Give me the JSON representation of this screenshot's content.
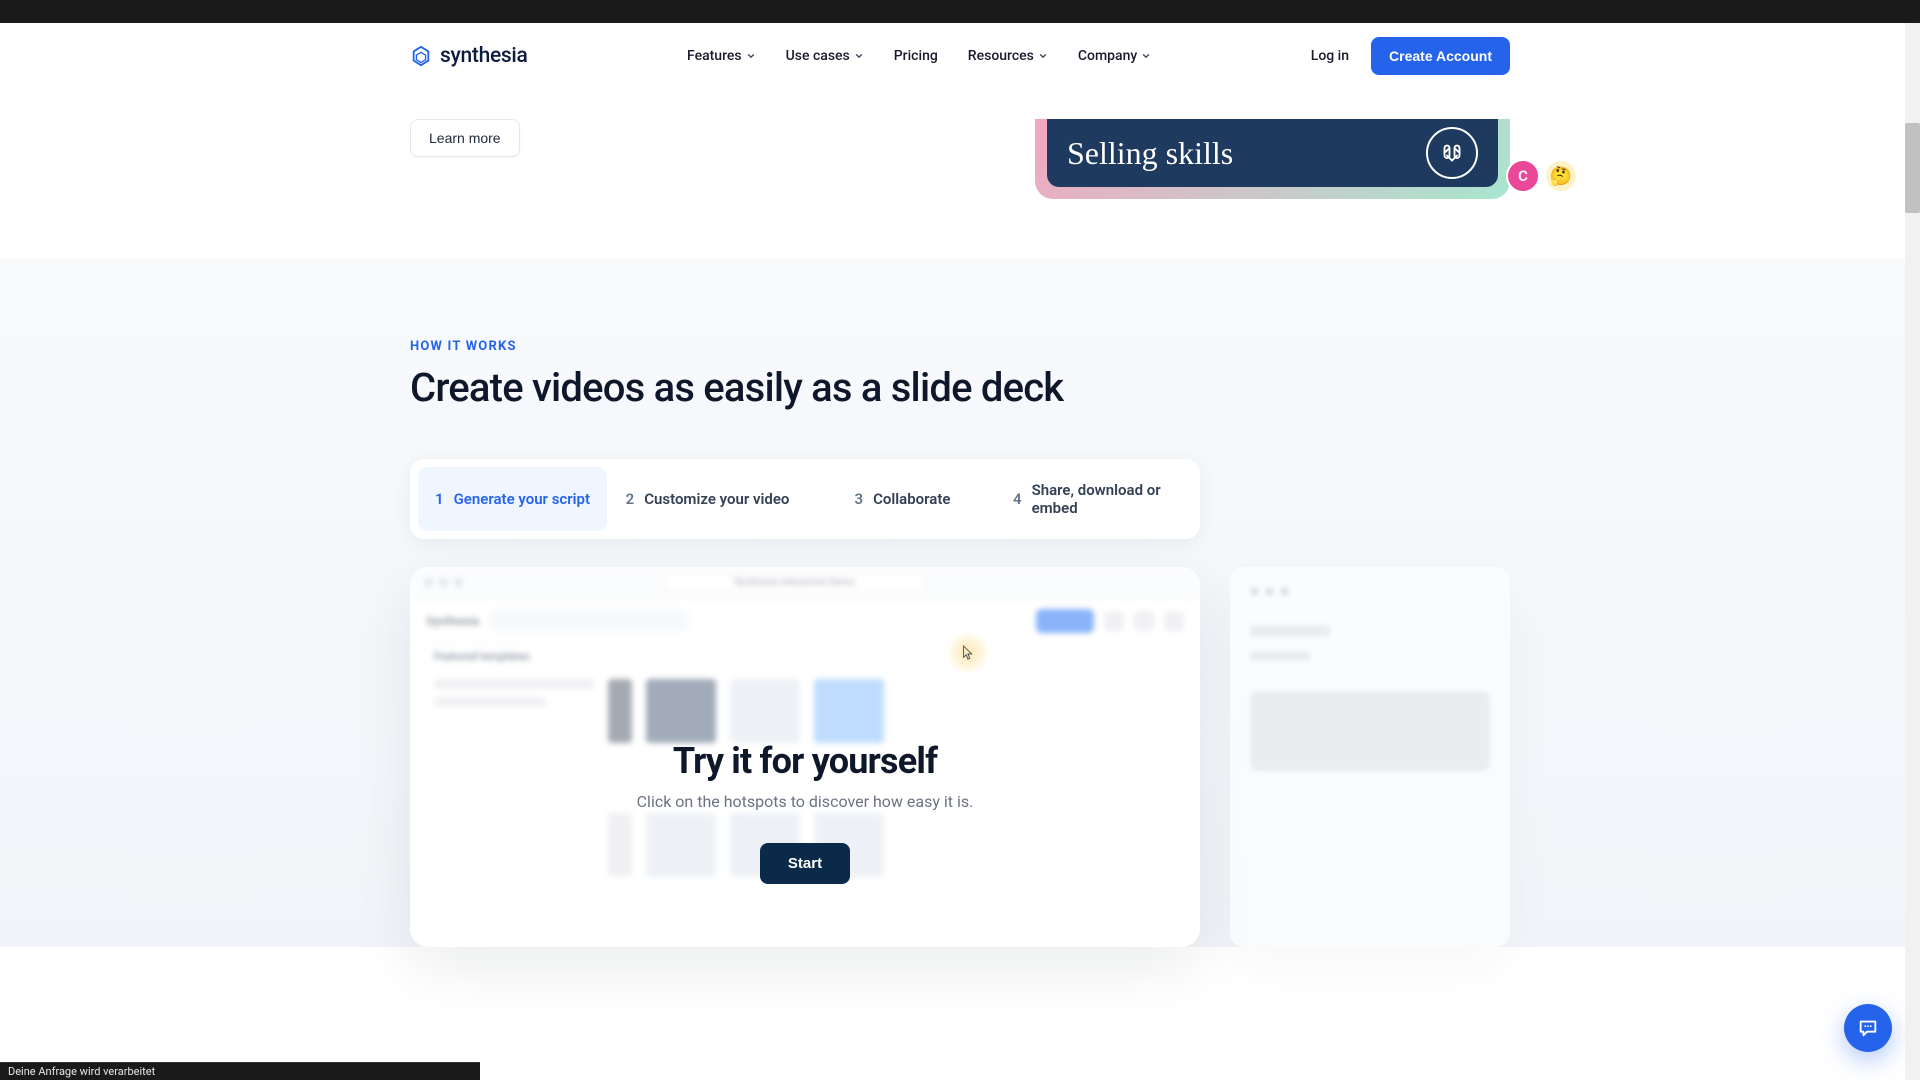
{
  "header": {
    "brand": "synthesia",
    "nav": [
      {
        "label": "Features",
        "dropdown": true
      },
      {
        "label": "Use cases",
        "dropdown": true
      },
      {
        "label": "Pricing",
        "dropdown": false
      },
      {
        "label": "Resources",
        "dropdown": true
      },
      {
        "label": "Company",
        "dropdown": true
      }
    ],
    "login": "Log in",
    "cta": "Create Account"
  },
  "topSection": {
    "learnMore": "Learn more",
    "cardTitle": "Selling skills",
    "reactionLetter": "C",
    "reactionEmoji": "🤔"
  },
  "howItWorks": {
    "eyebrow": "HOW IT WORKS",
    "heading": "Create videos as easily as a slide deck",
    "steps": [
      {
        "num": "1",
        "label": "Generate your script",
        "active": true
      },
      {
        "num": "2",
        "label": "Customize your video",
        "active": false
      },
      {
        "num": "3",
        "label": "Collaborate",
        "active": false
      },
      {
        "num": "4",
        "label": "Share, download or embed",
        "active": false
      }
    ]
  },
  "blurredApp": {
    "addressBar": "Synthesia Interactive Demo",
    "brand": "Synthesia",
    "generateLabel": "Generate",
    "sectionLabel": "Featured templates"
  },
  "overlay": {
    "title": "Try it for yourself",
    "subtitle": "Click on the hotspots to discover how easy it is.",
    "startButton": "Start"
  },
  "statusBar": {
    "message": "Deine Anfrage wird verarbeitet"
  },
  "colors": {
    "primary": "#2563eb",
    "dark": "#0b2a4a"
  }
}
